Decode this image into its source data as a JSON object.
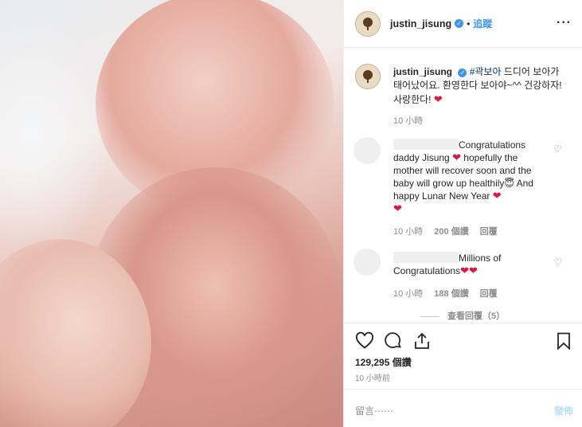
{
  "header": {
    "username": "justin_jisung",
    "verified_mark": "✓",
    "separator": "•",
    "follow_label": "追蹤",
    "more_label": "···"
  },
  "caption": {
    "username": "justin_jisung",
    "hashtag": "#곽보아",
    "text_part1": " 드디어 보아가 태어났어요. 환영한다 보아야~^^ 건강하자! 사랑한다! ",
    "heart": "❤",
    "time": "10 小時"
  },
  "comments": [
    {
      "text_part1": "Congratulations daddy Jisung ",
      "heart1": "❤",
      "text_part2": " hopefully the mother will recover soon and the baby will grow up healthily😇 And happy Lunar New Year ",
      "heart2": "❤",
      "heart3": "❤",
      "time": "10 小時",
      "likes": "200 個讚",
      "reply": "回覆"
    },
    {
      "text_part1": "Millions of Congratulations",
      "heart1": "❤",
      "heart2": "❤",
      "time": "10 小時",
      "likes": "188 個讚",
      "reply": "回覆"
    }
  ],
  "view_replies": "查看回覆（5）",
  "actions": {
    "likes_count": "129,295 個讚",
    "posted_time": "10 小時前"
  },
  "comment_input": {
    "placeholder": "留言⋯⋯",
    "post_label": "發佈"
  },
  "icons": {
    "like": "heart-outline-icon",
    "comment": "speech-bubble-icon",
    "share": "share-icon",
    "save": "bookmark-icon",
    "comment_like": "small-heart-icon",
    "avatar": "tree-logo-icon"
  },
  "colors": {
    "link_blue": "#3897f0",
    "heart_red": "#e3143d",
    "hashtag_blue": "#003569",
    "muted_gray": "#8e8e8e"
  }
}
